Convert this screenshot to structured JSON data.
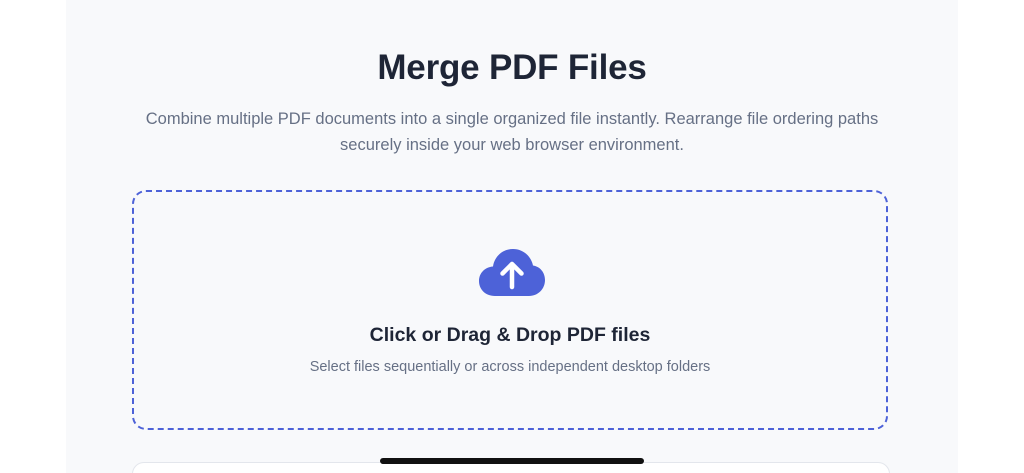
{
  "page": {
    "title": "Merge PDF Files",
    "subtitle": "Combine multiple PDF documents into a single organized file instantly. Rearrange file ordering paths securely inside your web browser environment."
  },
  "dropzone": {
    "icon": "cloud-upload-icon",
    "title": "Click or Drag & Drop PDF files",
    "hint": "Select files sequentially or across independent desktop folders"
  },
  "colors": {
    "accent": "#4d62d8",
    "heading": "#1e2536",
    "muted": "#667085",
    "panel_bg": "#f8f9fb"
  }
}
